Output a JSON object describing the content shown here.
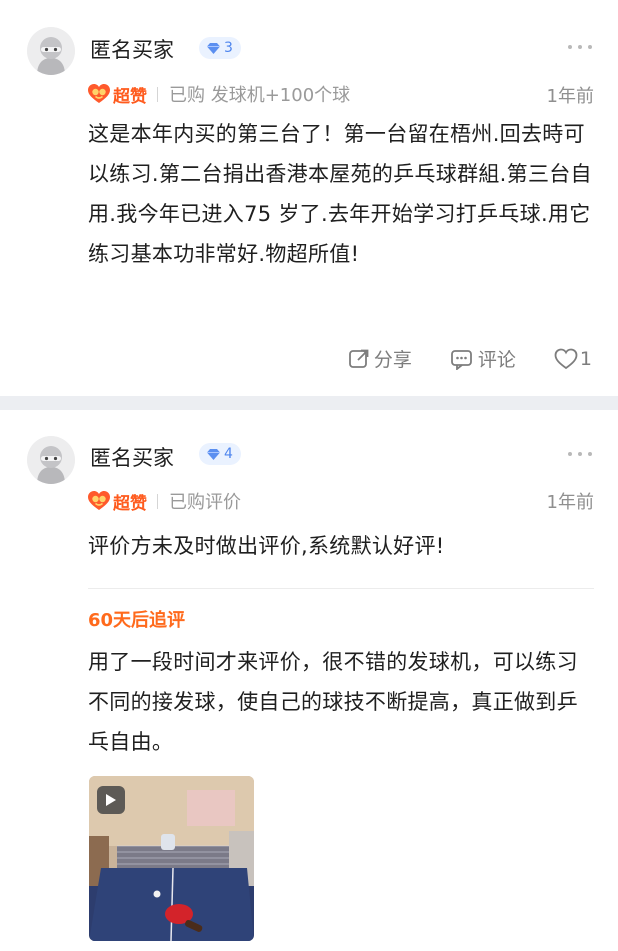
{
  "reviews": [
    {
      "username": "匿名买家",
      "level": "3",
      "badge": "超赞",
      "purchase": "已购 发球机+100个球",
      "time": "1年前",
      "content": "这是本年内买的第三台了！第一台留在梧州.回去時可以练习.第二台捐出香港本屋苑的乒乓球群組.第三台自用.我今年已进入75 岁了.去年开始学习打乒乓球.用它练习基本功非常好.物超所值!",
      "actions": {
        "share": "分享",
        "comment": "评论",
        "like_count": "1"
      }
    },
    {
      "username": "匿名买家",
      "level": "4",
      "badge": "超赞",
      "purchase": "已购评价",
      "time": "1年前",
      "content": "评价方未及时做出评价,系统默认好评!",
      "followup": {
        "title": "60天后追评",
        "content": "用了一段时间才来评价，很不错的发球机，可以练习不同的接发球，使自己的球技不断提高，真正做到乒乓自由。"
      }
    }
  ],
  "colors": {
    "accent_orange": "#ff5b1e",
    "level_blue": "#4f86ee",
    "divider": "#eceef2"
  },
  "icons": [
    "diamond-icon",
    "heart-face-icon",
    "share-icon",
    "comment-icon",
    "like-icon",
    "more-icon",
    "play-icon"
  ]
}
